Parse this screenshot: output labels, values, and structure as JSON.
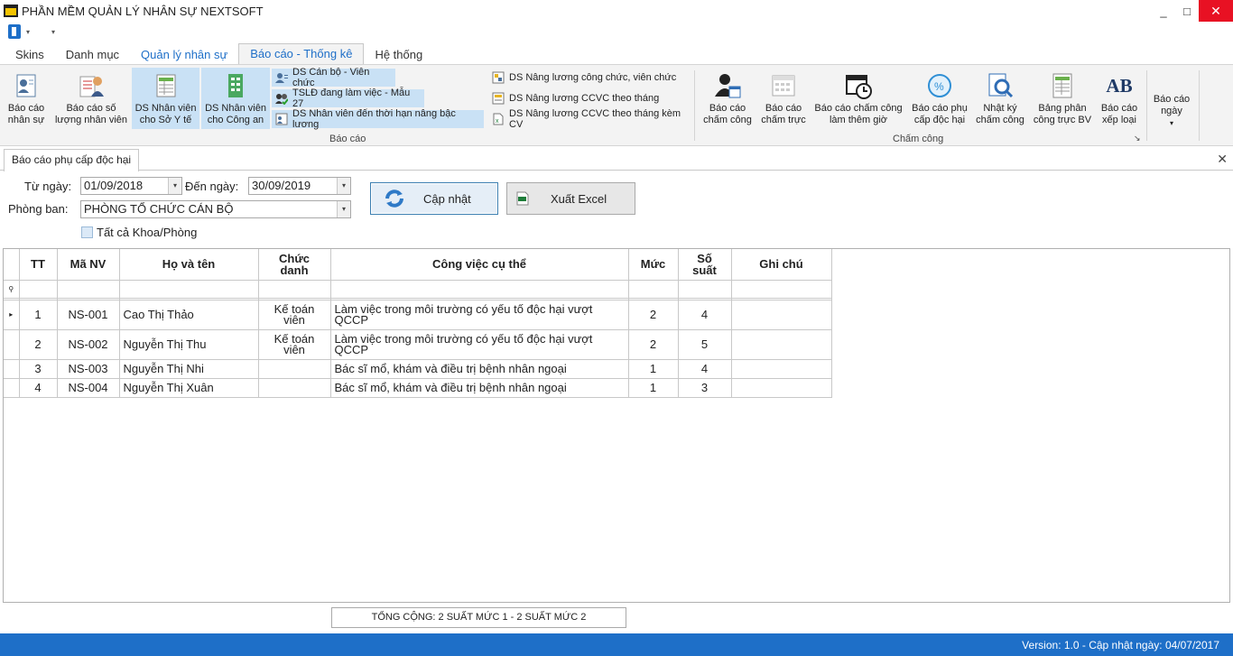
{
  "window": {
    "title": "PHẦN MỀM QUẢN LÝ NHÂN SỰ NEXTSOFT",
    "minimize": "_",
    "restore": "□",
    "close": "✕"
  },
  "qat": {
    "dropdown_glyph": "▾",
    "customize_glyph": "▾"
  },
  "tabs": [
    {
      "label": "Skins"
    },
    {
      "label": "Danh mục"
    },
    {
      "label": "Quản lý nhân sự"
    },
    {
      "label": "Báo cáo - Thống kê"
    },
    {
      "label": "Hệ thống"
    }
  ],
  "ribbon": {
    "bao_cao_group": {
      "label": "Báo cáo",
      "buttons": [
        {
          "label1": "Báo cáo",
          "label2": "nhân sự",
          "icon": "staff-report-icon"
        },
        {
          "label1": "Báo cáo số",
          "label2": "lượng nhân viên",
          "icon": "staff-count-icon"
        },
        {
          "label1": "DS Nhân viên",
          "label2": "cho Sở Y tế",
          "icon": "health-dept-list-icon"
        },
        {
          "label1": "DS Nhân viên",
          "label2": "cho Công an",
          "icon": "police-list-icon"
        }
      ],
      "small": [
        {
          "label": "DS Cán bộ - Viên chức",
          "icon": "officials-icon"
        },
        {
          "label": "TSLĐ đang làm việc - Mẫu 27",
          "icon": "workforce-icon"
        },
        {
          "label": "DS Nhân viên đến thời hạn nâng bậc lương",
          "icon": "salary-step-icon"
        },
        {
          "label": "DS Nâng lương công chức, viên chức",
          "icon": "salary-raise-icon"
        },
        {
          "label": "DS Nâng lương CCVC theo tháng",
          "icon": "monthly-raise-icon"
        },
        {
          "label": "DS Nâng lương CCVC theo tháng kèm CV",
          "icon": "excel-file-icon"
        }
      ]
    },
    "cham_cong_group": {
      "label": "Chấm công",
      "launcher": "↘",
      "buttons": [
        {
          "label1": "Báo cáo",
          "label2": "chấm công",
          "icon": "timesheet-user-icon"
        },
        {
          "label1": "Báo cáo",
          "label2": "chấm trực",
          "icon": "duty-calendar-icon"
        },
        {
          "label1": "Báo cáo chấm công",
          "label2": "làm thêm giờ",
          "icon": "overtime-clock-icon"
        },
        {
          "label1": "Báo cáo phụ",
          "label2": "cấp độc hại",
          "icon": "hazard-allowance-icon"
        },
        {
          "label1": "Nhật ký",
          "label2": "chấm công",
          "icon": "log-search-icon"
        },
        {
          "label1": "Bảng phân",
          "label2": "công trực BV",
          "icon": "duty-assignment-icon"
        },
        {
          "label1": "Báo cáo",
          "label2": "xếp loại",
          "icon": "ab-grade-icon",
          "icon_text": "AB"
        }
      ]
    },
    "extra": {
      "label1": "Báo cáo",
      "label2": "ngày",
      "arrow": "▾"
    }
  },
  "document": {
    "tab_label": "Báo cáo phụ cấp độc hại",
    "close_glyph": "✕"
  },
  "filters": {
    "from_label": "Từ ngày:",
    "from_value": "01/09/2018",
    "to_label": "Đến ngày:",
    "to_value": "30/09/2019",
    "dept_label": "Phòng ban:",
    "dept_value": "PHÒNG TỔ CHỨC CÁN BỘ",
    "all_depts_label": "Tất cả Khoa/Phòng",
    "all_depts_checked": false,
    "dropdown_glyph": "▾"
  },
  "actions": {
    "update_label": "Cập nhật",
    "export_label": "Xuất Excel"
  },
  "grid": {
    "columns": [
      "TT",
      "Mã NV",
      "Họ và tên",
      "Chức\ndanh",
      "Công việc cụ thể",
      "Mức",
      "Số\nsuất",
      "Ghi chú"
    ],
    "filter_glyph": "⚲",
    "current_row_glyph": "▸",
    "rows": [
      {
        "tt": "1",
        "ma_nv": "NS-001",
        "ho_ten": "Cao Thị Thảo",
        "chuc_danh": "Kế toán viên",
        "cong_viec": "Làm việc trong môi trường có yếu tố độc hại vượt QCCP",
        "muc": "2",
        "so_suat": "4",
        "ghi_chu": ""
      },
      {
        "tt": "2",
        "ma_nv": "NS-002",
        "ho_ten": "Nguyễn Thị Thu",
        "chuc_danh": "Kế toán viên",
        "cong_viec": "Làm việc trong môi trường có yếu tố độc hại vượt QCCP",
        "muc": "2",
        "so_suat": "5",
        "ghi_chu": ""
      },
      {
        "tt": "3",
        "ma_nv": "NS-003",
        "ho_ten": "Nguyễn Thị Nhi",
        "chuc_danh": "",
        "cong_viec": "Bác sĩ mổ, khám và điều trị bệnh nhân ngoại",
        "muc": "1",
        "so_suat": "4",
        "ghi_chu": ""
      },
      {
        "tt": "4",
        "ma_nv": "NS-004",
        "ho_ten": "Nguyễn Thị Xuân",
        "chuc_danh": "",
        "cong_viec": "Bác sĩ mổ, khám và điều trị bệnh nhân ngoại",
        "muc": "1",
        "so_suat": "3",
        "ghi_chu": ""
      }
    ]
  },
  "summary": "TỔNG CỘNG: 2 SUẤT MỨC 1 - 2 SUẤT MỨC 2",
  "status": "Version: 1.0 - Cập nhật ngày: 04/07/2017",
  "colors": {
    "accent": "#1e6fc8",
    "ribbon_bg": "#f3f3f3",
    "highlight": "#c9e1f5",
    "close_red": "#e81123"
  }
}
